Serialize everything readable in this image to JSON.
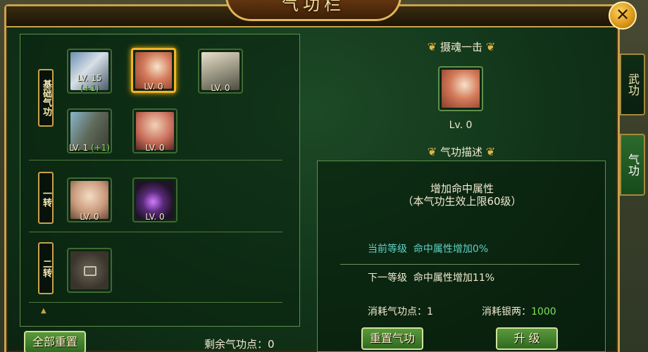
{
  "window": {
    "title": "气功栏",
    "close_glyph": "✕"
  },
  "rows": [
    {
      "tag": "基础气功",
      "skills": [
        {
          "level": "LV. 15",
          "bonus": "(+1)",
          "icon": "fist-chain-icon"
        },
        {
          "level": "LV. 0",
          "bonus": "",
          "icon": "blade-strike-icon",
          "selected": true
        },
        {
          "level": "LV. 0",
          "bonus": "",
          "icon": "armor-scroll-icon"
        },
        {
          "level": "LV. 1",
          "bonus": "(+1)",
          "icon": "stone-wall-icon"
        },
        {
          "level": "LV. 0",
          "bonus": "",
          "icon": "swordsman-portrait-icon"
        }
      ]
    },
    {
      "tag": "一转",
      "skills": [
        {
          "level": "LV. 0",
          "bonus": "",
          "icon": "palm-icon"
        },
        {
          "level": "LV. 0",
          "bonus": "",
          "icon": "purple-orb-icon"
        }
      ]
    },
    {
      "tag": "二转",
      "skills": [
        {
          "level": "",
          "bonus": "",
          "icon": "locked-skill-icon"
        }
      ]
    }
  ],
  "left": {
    "reset_all_label": "全部重置",
    "remaining_label": "剩余气功点：0"
  },
  "detail": {
    "skill_name": "摄魂一击",
    "level": "Lv. 0",
    "desc_title": "气功描述",
    "desc_line1": "增加命中属性",
    "desc_line2": "（本气功生效上限60级）",
    "current_label": "当前等级",
    "current_value": "命中属性增加0%",
    "next_label": "下一等级",
    "next_value": "命中属性增加11%",
    "cost_points_label": "消耗气功点：",
    "cost_points_value": "1",
    "cost_silver_label": "消耗银两：",
    "cost_silver_value": "1000",
    "reset_label": "重置气功",
    "upgrade_label": "升 级"
  },
  "tabs": [
    {
      "label": "武功",
      "active": false
    },
    {
      "label": "气功",
      "active": true
    }
  ],
  "colors": {
    "frame_gold": "#c9a24a",
    "panel_green": "#113419",
    "highlight": "#f5b326",
    "cyan_text": "#5ed3c6",
    "green_text": "#7fe05a"
  }
}
